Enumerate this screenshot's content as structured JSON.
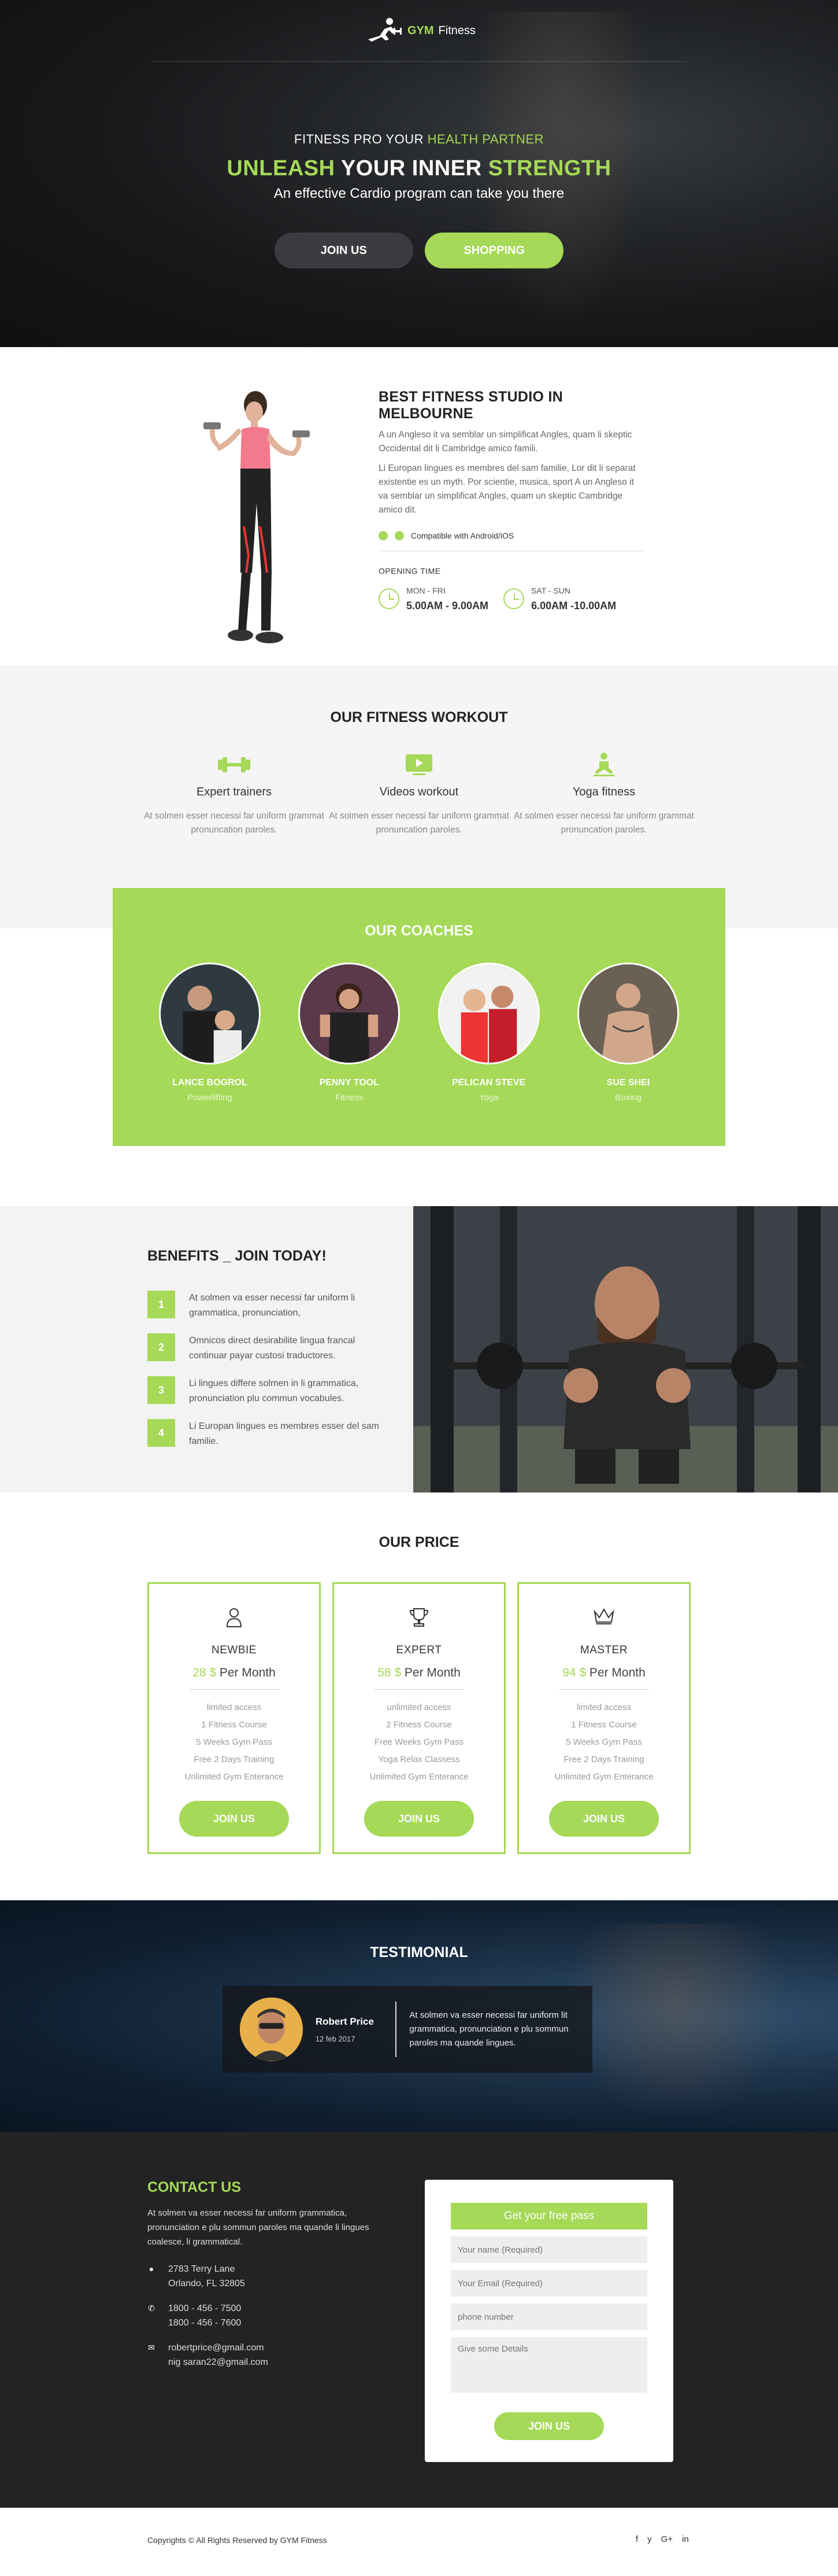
{
  "header": {
    "brand_main": "GYM",
    "brand_sub": "Fitness"
  },
  "hero": {
    "kicker_a": "FITNESS PRO YOUR",
    "kicker_b": "HEALTH PARTNER",
    "title_a": "UNLEASH",
    "title_b": "YOUR INNER",
    "title_c": "STRENGTH",
    "subtitle": "An effective Cardio program can take you there",
    "join_label": "JOIN US",
    "shop_label": "SHOPPING"
  },
  "about": {
    "title": "BEST FITNESS STUDIO IN MELBOURNE",
    "para1": "A un Angleso it va semblar un simplificat Angles, quam li skeptic Occidental dit li Cambridge amico famili.",
    "para2": "Li Europan lingues es membres del sam familie, Lor dit li separat existentie es un myth. Por scientie, musica, sport A un Angleso it va semblar un simplificat Angles, quam un skeptic Cambridge amico dit.",
    "compat": "Compatible with Android/iOS",
    "opening_title": "OPENING TIME",
    "hours": [
      {
        "day": "MON - FRI",
        "time": "5.00AM - 9.00AM"
      },
      {
        "day": "SAT - SUN",
        "time": "6.00AM -10.00AM"
      }
    ]
  },
  "workout": {
    "title": "OUR FITNESS WORKOUT",
    "items": [
      {
        "icon": "dumbbell-icon",
        "title": "Expert trainers",
        "text": "At solmen esser necessi far uniform grammat pronuncation paroles."
      },
      {
        "icon": "video-icon",
        "title": "Videos workout",
        "text": "At solmen esser necessi far uniform grammat pronuncation paroles."
      },
      {
        "icon": "yoga-icon",
        "title": "Yoga fitness",
        "text": "At solmen esser necessi far uniform grammat pronuncation paroles."
      }
    ]
  },
  "coaches": {
    "title": "OUR COACHES",
    "items": [
      {
        "name": "LANCE BOGROL",
        "role": "Powerlifting"
      },
      {
        "name": "PENNY TOOL",
        "role": "Fitness"
      },
      {
        "name": "PELICAN STEVE",
        "role": "Yoga"
      },
      {
        "name": "SUE SHEI",
        "role": "Boxing"
      }
    ]
  },
  "benefits": {
    "title": "BENEFITS _ JOIN TODAY!",
    "items": [
      {
        "num": "1",
        "text": "At solmen va esser necessi far uniform li grammatica, pronunciation,"
      },
      {
        "num": "2",
        "text": "Omnicos direct desirabilite lingua francal continuar payar custosi traductores."
      },
      {
        "num": "3",
        "text": "Li lingues differe solmen in li grammatica, pronunciation plu commun vocabules."
      },
      {
        "num": "4",
        "text": "Li Europan lingues es membres esser del sam familie."
      }
    ]
  },
  "price": {
    "title": "OUR PRICE",
    "plans": [
      {
        "icon": "user-icon",
        "name": "NEWBIE",
        "amount": "28 $",
        "period": "Per Month",
        "features": [
          "limited access",
          "1 Fitness Course",
          "5 Weeks Gym Pass",
          "Free 2 Days Training",
          "Unlimited Gym Enterance"
        ],
        "cta": "JOIN US"
      },
      {
        "icon": "trophy-icon",
        "name": "EXPERT",
        "amount": "58 $",
        "period": "Per Month",
        "features": [
          "unlimited access",
          "2 Fitness Course",
          "Free Weeks Gym Pass",
          "Yoga Relax Classess",
          "Unlimited Gym Enterance"
        ],
        "cta": "JOIN US"
      },
      {
        "icon": "crown-icon",
        "name": "MASTER",
        "amount": "94 $",
        "period": "Per Month",
        "features": [
          "limited access",
          "1 Fitness Course",
          "5 Weeks Gym Pass",
          "Free 2 Days Training",
          "Unlimited Gym Enterance"
        ],
        "cta": "JOIN US"
      }
    ]
  },
  "testimonial": {
    "title": "TESTIMONIAL",
    "name": "Robert Price",
    "date": "12 feb 2017",
    "quote": "At solmen va esser necessi far uniform lit grammatica, pronunciation e plu sommun paroles ma quande lingues."
  },
  "contact": {
    "title": "CONTACT US",
    "intro": "At solmen va esser necessi far uniform grammatica, pronunciation e plu sommun paroles ma quande li lingues coalesce, li grammatical.",
    "address_1": "2783 Terry Lane",
    "address_2": "Orlando, FL 32805",
    "phone_1": "1800 - 456 - 7500",
    "phone_2": "1800 - 456 - 7600",
    "email_1": "robertprice@gmail.com",
    "email_2": "nig saran22@gmail.com",
    "form": {
      "head": "Get your free pass",
      "name_ph": "Your name (Required)",
      "email_ph": "Your Email (Required)",
      "phone_ph": "phone number",
      "details_ph": "Give some Details",
      "submit": "JOIN US"
    }
  },
  "footer": {
    "copyright": "Copyrights © All Rights Reserved by GYM Fitness",
    "social": [
      "f",
      "y",
      "G+",
      "in"
    ]
  },
  "colors": {
    "accent": "#a5d957",
    "dark": "#232323",
    "light_bg": "#f5f5f5"
  }
}
